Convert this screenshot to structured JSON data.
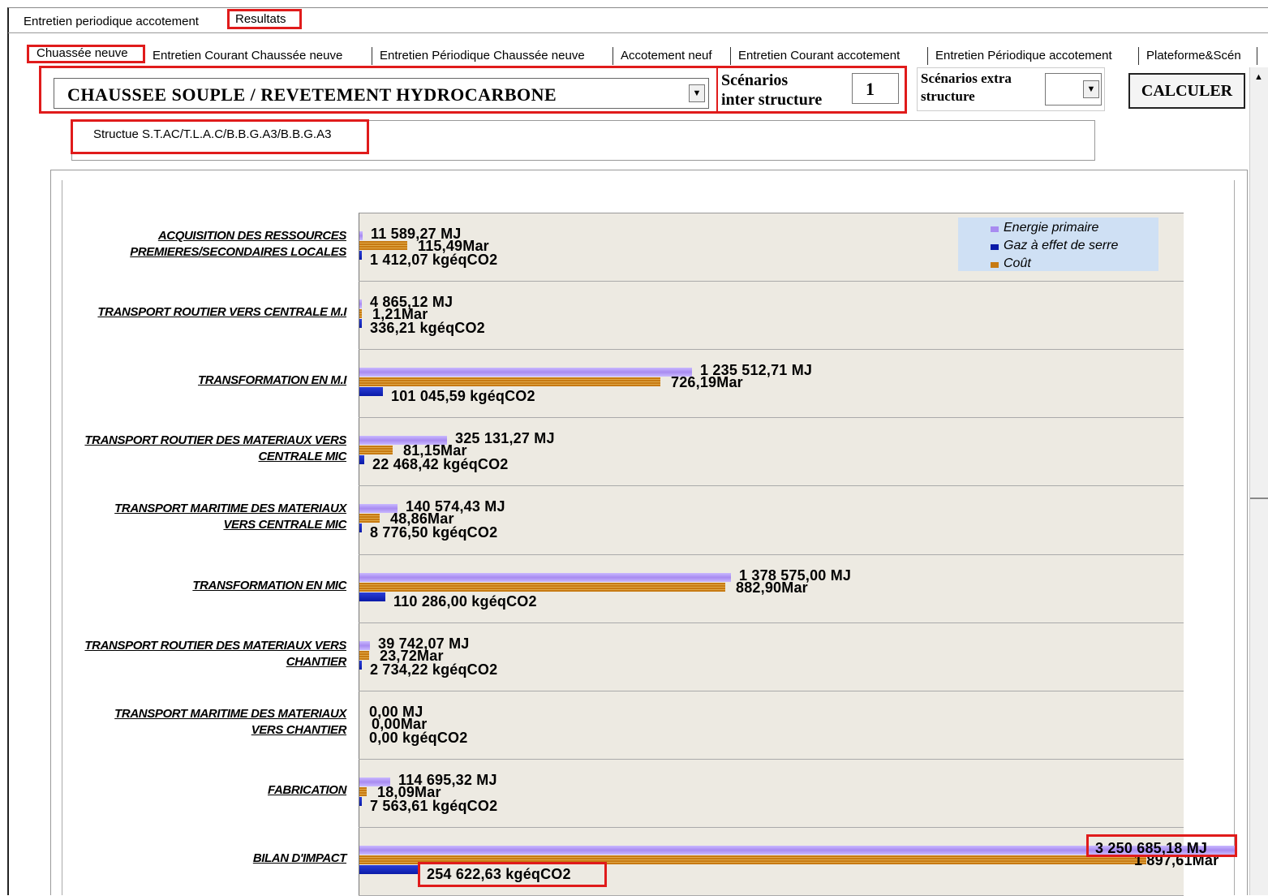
{
  "top_tabs": [
    "Entretien periodique accotement",
    "Resultats"
  ],
  "sub_tabs": [
    "Chuassée neuve",
    "Entretien Courant Chaussée neuve",
    "Entretien Périodique Chaussée neuve",
    "Accotement neuf",
    "Entretien Courant accotement",
    "Entretien Périodique accotement",
    "Plateforme&Scén"
  ],
  "controls": {
    "structure_type": "CHAUSSEE SOUPLE / REVETEMENT HYDROCARBONE",
    "scenarios_inter_label_1": "Scénarios",
    "scenarios_inter_label_2": "inter structure",
    "scenarios_inter_value": "1",
    "scenarios_extra_label_1": "Scénarios extra",
    "scenarios_extra_label_2": "structure",
    "scenarios_extra_value": "",
    "calculate_label": "CALCULER"
  },
  "structure_description": "Structue S.T.AC/T.L.A.C/B.B.G.A3/B.B.G.A3",
  "icons": {
    "dropdown": "chevron-down-icon",
    "scroll_up": "arrow-up-icon"
  },
  "chart_data": {
    "type": "bar",
    "orientation": "horizontal",
    "categories": [
      [
        "ACQUISITION DES RESSOURCES",
        "PREMIERES/SECONDAIRES LOCALES"
      ],
      [
        "TRANSPORT ROUTIER VERS CENTRALE M.I"
      ],
      [
        "TRANSFORMATION EN M.I"
      ],
      [
        "TRANSPORT ROUTIER DES MATERIAUX  VERS",
        "CENTRALE MIC"
      ],
      [
        "TRANSPORT MARITIME DES MATERIAUX",
        "VERS CENTRALE MIC"
      ],
      [
        "TRANSFORMATION EN MIC"
      ],
      [
        "TRANSPORT ROUTIER DES MATERIAUX  VERS",
        "CHANTIER"
      ],
      [
        "TRANSPORT MARITIME DES MATERIAUX",
        "VERS CHANTIER"
      ],
      [
        "FABRICATION"
      ],
      [
        "BILAN D'IMPACT"
      ]
    ],
    "series": [
      {
        "name": "Energie primaire",
        "color": "#a88bf0",
        "unit": "MJ",
        "values": [
          11589.27,
          4865.12,
          1235512.71,
          325131.27,
          140574.43,
          1378575.0,
          39742.07,
          0.0,
          114695.32,
          3250685.18
        ],
        "labels": [
          "11 589,27 MJ",
          "4 865,12 MJ",
          "1 235 512,71 MJ",
          "325 131,27 MJ",
          "140 574,43 MJ",
          "1 378 575,00 MJ",
          "39 742,07 MJ",
          "0,00 MJ",
          "114 695,32 MJ",
          "3 250 685,18 MJ"
        ]
      },
      {
        "name": "Coût",
        "color": "#c77a12",
        "unit": "Mar",
        "values": [
          115.49,
          1.21,
          726.19,
          81.15,
          48.86,
          882.9,
          23.72,
          0.0,
          18.09,
          1897.61
        ],
        "labels": [
          "115,49Mar",
          "1,21Mar",
          "726,19Mar",
          "81,15Mar",
          "48,86Mar",
          "882,90Mar",
          "23,72Mar",
          "0,00Mar",
          "18,09Mar",
          "1 897,61Mar"
        ]
      },
      {
        "name": "Gaz à effet de serre",
        "color": "#0a1aa8",
        "unit": "kgéqCO2",
        "values": [
          1412.07,
          336.21,
          101045.59,
          22468.42,
          8776.5,
          110286.0,
          2734.22,
          0.0,
          7563.61,
          254622.63
        ],
        "labels": [
          "1 412,07 kgéqCO2",
          "336,21 kgéqCO2",
          "101 045,59 kgéqCO2",
          "22 468,42 kgéqCO2",
          "8 776,50 kgéqCO2",
          "110 286,00 kgéqCO2",
          "2 734,22 kgéqCO2",
          "0,00 kgéqCO2",
          "7 563,61 kgéqCO2",
          "254 622,63 kgéqCO2"
        ]
      }
    ],
    "legend": {
      "position": "top-right",
      "entries": [
        {
          "name": "Energie primaire",
          "color": "#a88bf0"
        },
        {
          "name": "Gaz à effet de serre",
          "color": "#0a1aa8"
        },
        {
          "name": "Coût",
          "color": "#c77a12"
        }
      ]
    }
  }
}
